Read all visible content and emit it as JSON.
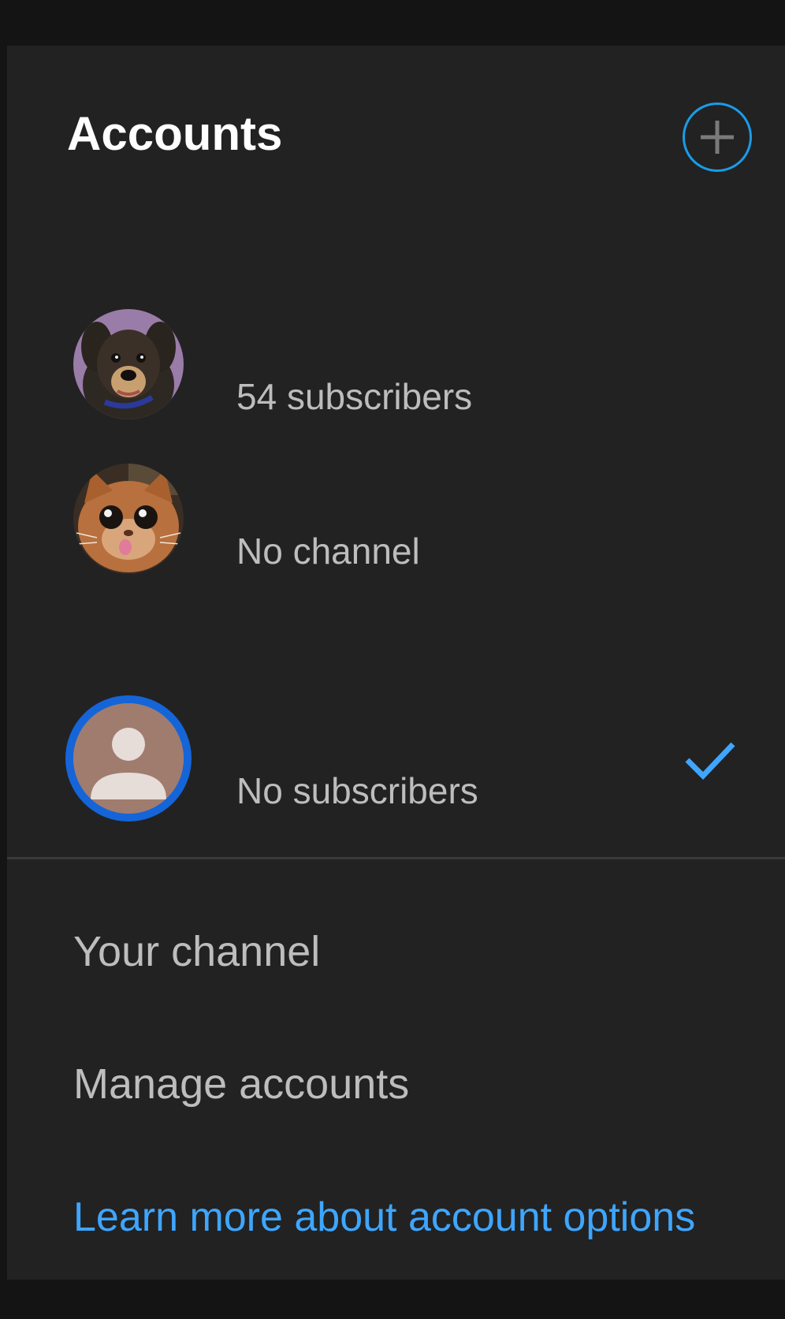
{
  "header": {
    "title": "Accounts",
    "add_icon": "plus-circle-icon"
  },
  "accounts": [
    {
      "subtitle": "54 subscribers",
      "avatar": "dog-photo-avatar",
      "selected": false
    },
    {
      "subtitle": "No channel",
      "avatar": "cat-photo-avatar",
      "selected": false
    },
    {
      "subtitle": "No subscribers",
      "avatar": "default-person-avatar",
      "selected": true
    }
  ],
  "selected_icon": "checkmark-icon",
  "menu": {
    "your_channel": "Your channel",
    "manage_accounts": "Manage accounts",
    "learn_more": "Learn more about account options"
  },
  "colors": {
    "background": "#222222",
    "accent": "#3ea6ff",
    "selected_ring": "#1565d8",
    "add_ring": "#1a9ce8"
  }
}
